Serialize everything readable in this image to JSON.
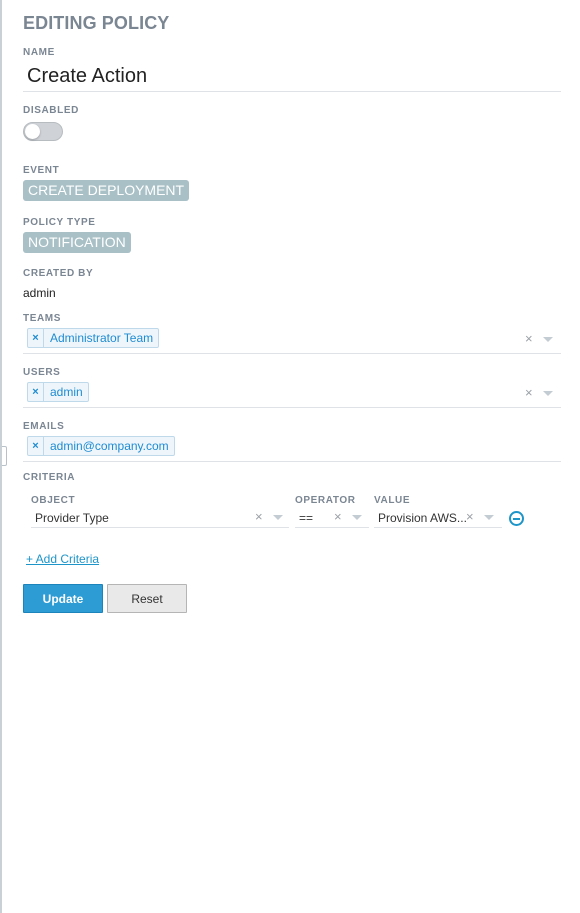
{
  "header": {
    "title": "EDITING POLICY"
  },
  "name": {
    "label": "NAME",
    "value": "Create Action"
  },
  "disabled": {
    "label": "DISABLED",
    "on": false
  },
  "event": {
    "label": "EVENT",
    "value": "CREATE DEPLOYMENT"
  },
  "policy_type": {
    "label": "POLICY TYPE",
    "value": "NOTIFICATION"
  },
  "created_by": {
    "label": "CREATED BY",
    "value": "admin"
  },
  "teams": {
    "label": "TEAMS",
    "chips": [
      "Administrator Team"
    ]
  },
  "users": {
    "label": "USERS",
    "chips": [
      "admin"
    ]
  },
  "emails": {
    "label": "EMAILS",
    "chips": [
      "admin@company.com"
    ]
  },
  "criteria": {
    "label": "CRITERIA",
    "columns": {
      "object": "OBJECT",
      "operator": "OPERATOR",
      "value": "VALUE"
    },
    "rows": [
      {
        "object": "Provider Type",
        "operator": "==",
        "value": "Provision AWS..."
      }
    ],
    "add_label": "+ Add Criteria"
  },
  "actions": {
    "update_label": "Update",
    "reset_label": "Reset"
  },
  "glyphs": {
    "clear": "×"
  },
  "colors": {
    "accent": "#2d9cd5",
    "tag": "#a8c0c6",
    "label": "#7b8693"
  }
}
